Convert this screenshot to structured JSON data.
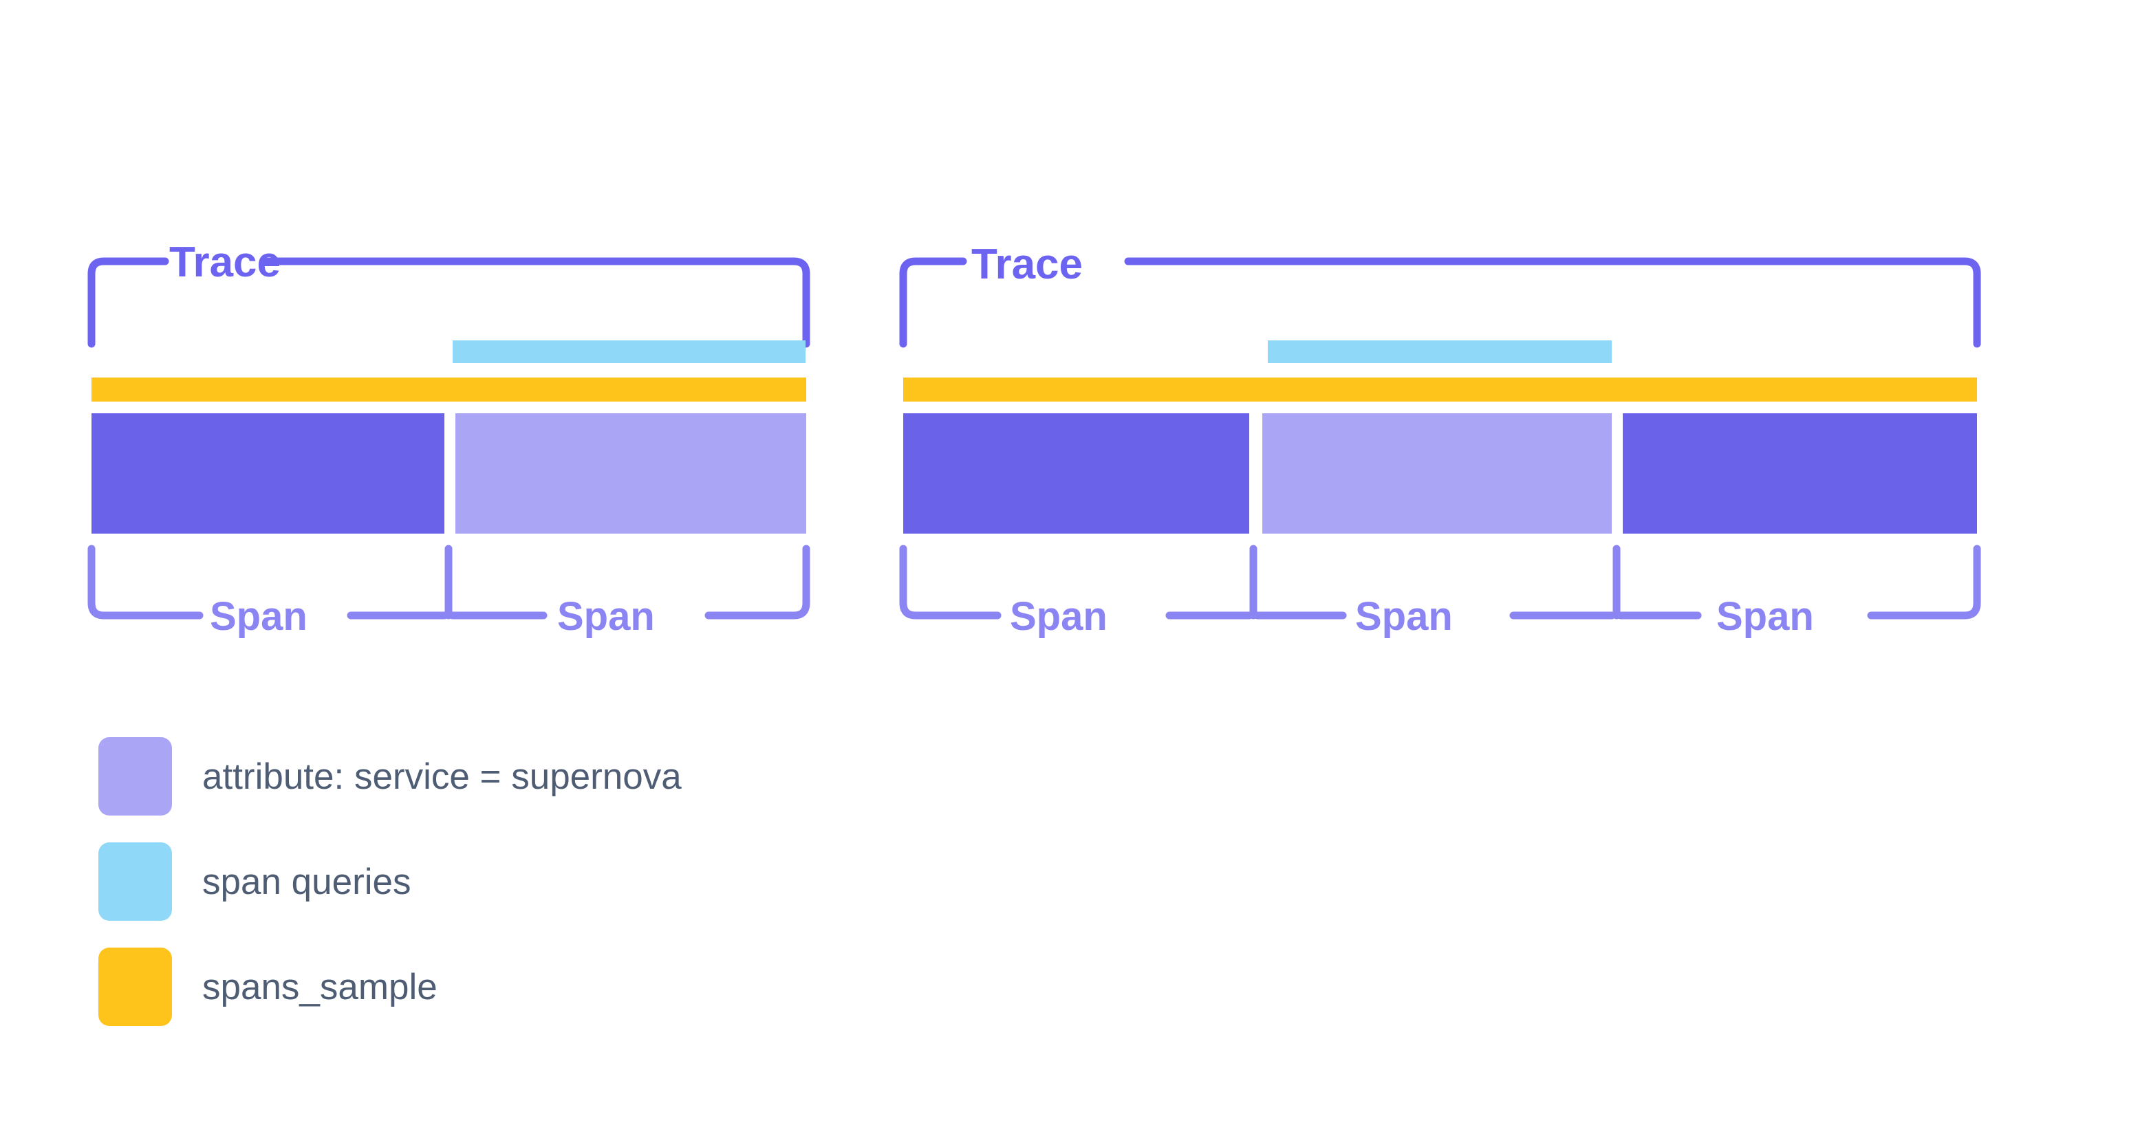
{
  "diagram": {
    "title": "Trace and span sampling diagram",
    "colors": {
      "trace_bracket": "#6c63f0",
      "span_bracket": "#8b85f3",
      "span_dark": "#6a63ea",
      "span_light": "#aaa5f5",
      "span_queries_bar": "#90d8f8",
      "spans_sample_bar": "#fec41b",
      "legend_text": "#4e5d74",
      "background": "#ffffff"
    },
    "traces": [
      {
        "label": "Trace",
        "spans": [
          {
            "label": "Span",
            "color_key": "span_dark"
          },
          {
            "label": "Span",
            "color_key": "span_light"
          }
        ],
        "bars": [
          {
            "name": "span queries",
            "color_key": "span_queries_bar"
          },
          {
            "name": "spans_sample",
            "color_key": "spans_sample_bar"
          }
        ]
      },
      {
        "label": "Trace",
        "spans": [
          {
            "label": "Span",
            "color_key": "span_dark"
          },
          {
            "label": "Span",
            "color_key": "span_light"
          },
          {
            "label": "Span",
            "color_key": "span_dark"
          }
        ],
        "bars": [
          {
            "name": "span queries",
            "color_key": "span_queries_bar"
          },
          {
            "name": "spans_sample",
            "color_key": "spans_sample_bar"
          }
        ]
      }
    ]
  },
  "legend": {
    "items": [
      {
        "label": "attribute: service = supernova",
        "color": "#aaa5f5"
      },
      {
        "label": "span queries",
        "color": "#90d8f8"
      },
      {
        "label": "spans_sample",
        "color": "#fec41b"
      }
    ]
  }
}
